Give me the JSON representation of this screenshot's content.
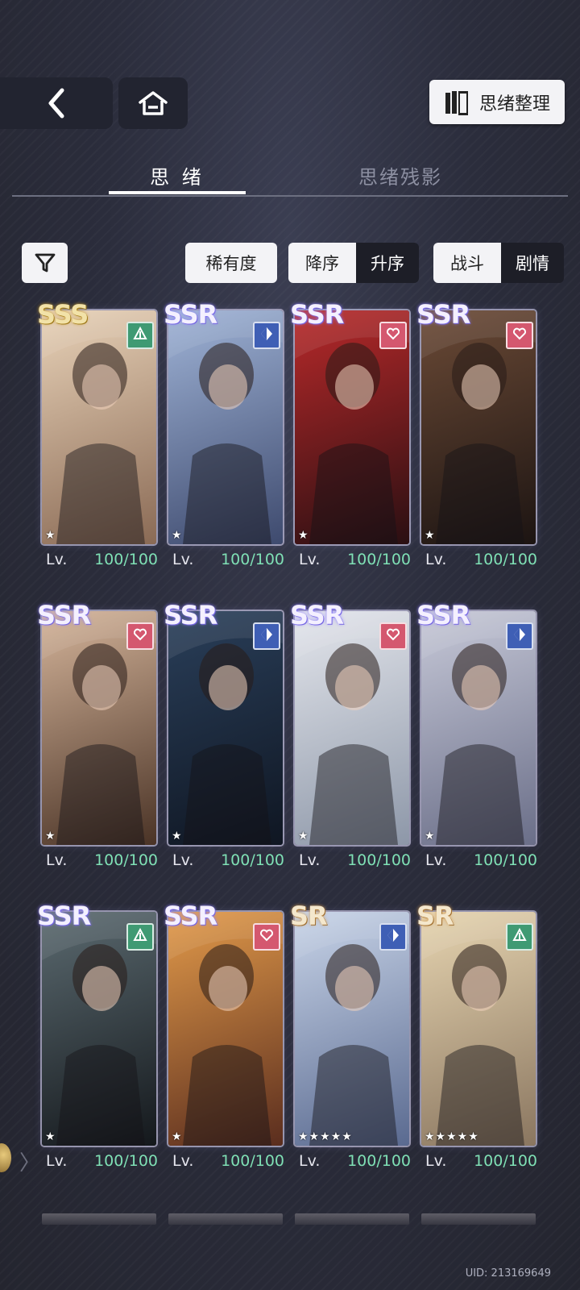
{
  "header": {
    "organize_label": "思绪整理"
  },
  "tabs": [
    {
      "label": "思 绪",
      "active": true
    },
    {
      "label": "思绪残影",
      "active": false
    }
  ],
  "filters": {
    "rarity_label": "稀有度",
    "order": [
      "降序",
      "升序"
    ],
    "mode": [
      "战斗",
      "剧情"
    ]
  },
  "lv_label": "Lv.",
  "cards": [
    {
      "rarity": "SSS",
      "badge": "green",
      "badge_icon": "triangle-icon",
      "stars": "★",
      "level": "100/100"
    },
    {
      "rarity": "SSR",
      "badge": "blue",
      "badge_icon": "diamond-icon",
      "stars": "★",
      "level": "100/100"
    },
    {
      "rarity": "SSR",
      "badge": "pink",
      "badge_icon": "heart-icon",
      "stars": "★",
      "level": "100/100"
    },
    {
      "rarity": "SSR",
      "badge": "pink",
      "badge_icon": "heart-icon",
      "stars": "★",
      "level": "100/100"
    },
    {
      "rarity": "SSR",
      "badge": "pink",
      "badge_icon": "heart-icon",
      "stars": "★",
      "level": "100/100"
    },
    {
      "rarity": "SSR",
      "badge": "blue",
      "badge_icon": "diamond-icon",
      "stars": "★",
      "level": "100/100"
    },
    {
      "rarity": "SSR",
      "badge": "pink",
      "badge_icon": "heart-icon",
      "stars": "★",
      "level": "100/100"
    },
    {
      "rarity": "SSR",
      "badge": "blue",
      "badge_icon": "diamond-icon",
      "stars": "★",
      "level": "100/100"
    },
    {
      "rarity": "SSR",
      "badge": "green",
      "badge_icon": "triangle-icon",
      "stars": "★",
      "level": "100/100"
    },
    {
      "rarity": "SSR",
      "badge": "pink",
      "badge_icon": "heart-icon",
      "stars": "★",
      "level": "100/100"
    },
    {
      "rarity": "SR",
      "badge": "blue",
      "badge_icon": "diamond-icon",
      "stars": "★★★★★",
      "level": "100/100"
    },
    {
      "rarity": "SR",
      "badge": "green",
      "badge_icon": "triangle-icon",
      "stars": "★★★★★",
      "level": "100/100"
    }
  ],
  "uid": "UID: 213169649",
  "colors": {
    "level_green": "#7fe0b5",
    "badge_green": "#3f9a73",
    "badge_blue": "#3f5fb5",
    "badge_pink": "#d4586f"
  }
}
